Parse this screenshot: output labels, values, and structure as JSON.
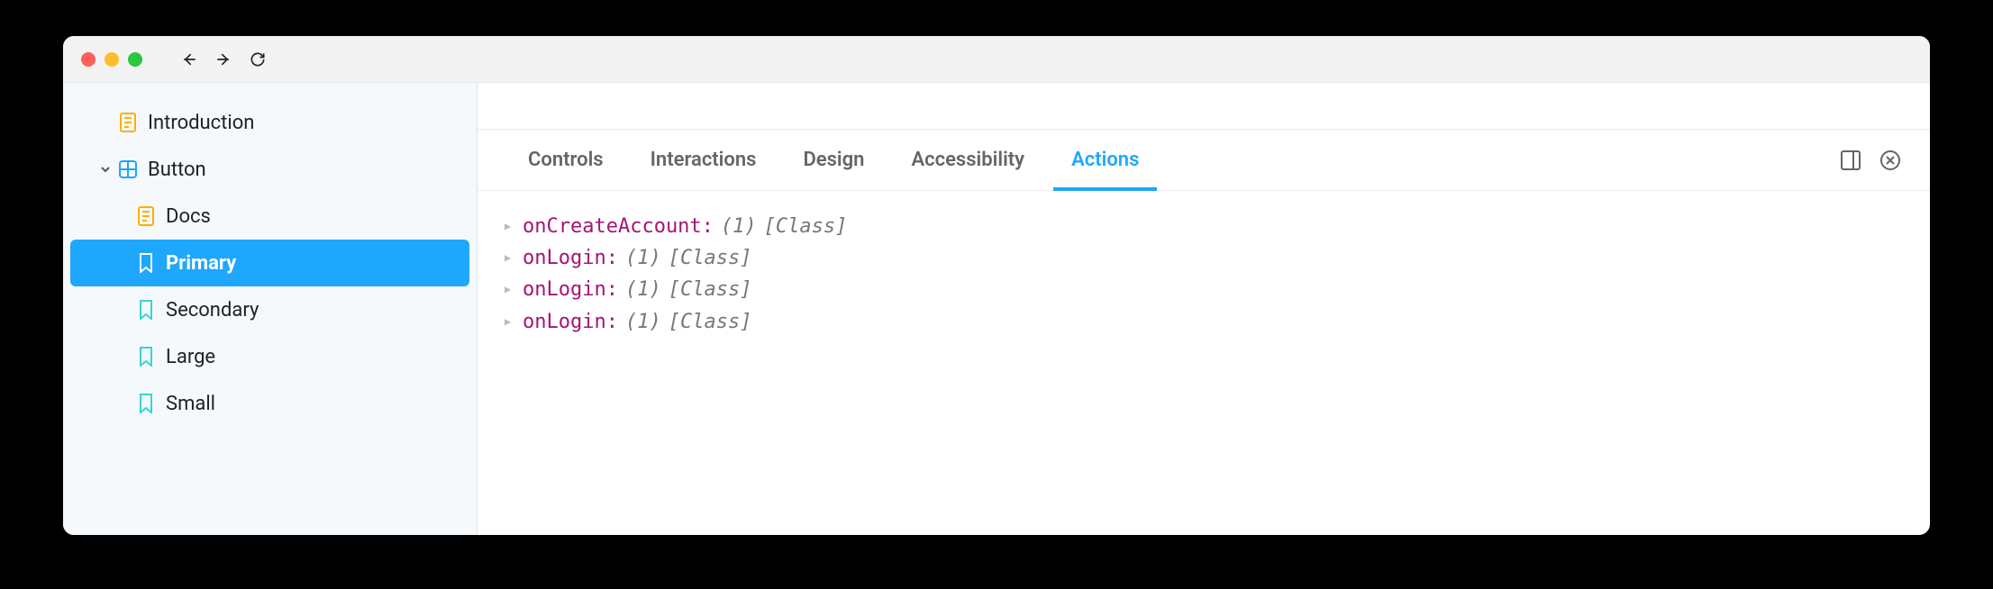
{
  "sidebar": {
    "items": [
      {
        "label": "Introduction",
        "icon": "doc",
        "depth": 1,
        "expandable": false
      },
      {
        "label": "Button",
        "icon": "component",
        "depth": 1,
        "expandable": true,
        "expanded": true
      },
      {
        "label": "Docs",
        "icon": "doc",
        "depth": 2,
        "expandable": false
      },
      {
        "label": "Primary",
        "icon": "story",
        "depth": 2,
        "expandable": false,
        "selected": true
      },
      {
        "label": "Secondary",
        "icon": "story",
        "depth": 2,
        "expandable": false
      },
      {
        "label": "Large",
        "icon": "story",
        "depth": 2,
        "expandable": false
      },
      {
        "label": "Small",
        "icon": "story",
        "depth": 2,
        "expandable": false
      }
    ]
  },
  "tabs": [
    {
      "label": "Controls",
      "active": false
    },
    {
      "label": "Interactions",
      "active": false
    },
    {
      "label": "Design",
      "active": false
    },
    {
      "label": "Accessibility",
      "active": false
    },
    {
      "label": "Actions",
      "active": true
    }
  ],
  "actions": [
    {
      "name": "onCreateAccount",
      "count": "(1)",
      "type": "[Class]"
    },
    {
      "name": "onLogin",
      "count": "(1)",
      "type": "[Class]"
    },
    {
      "name": "onLogin",
      "count": "(1)",
      "type": "[Class]"
    },
    {
      "name": "onLogin",
      "count": "(1)",
      "type": "[Class]"
    }
  ]
}
